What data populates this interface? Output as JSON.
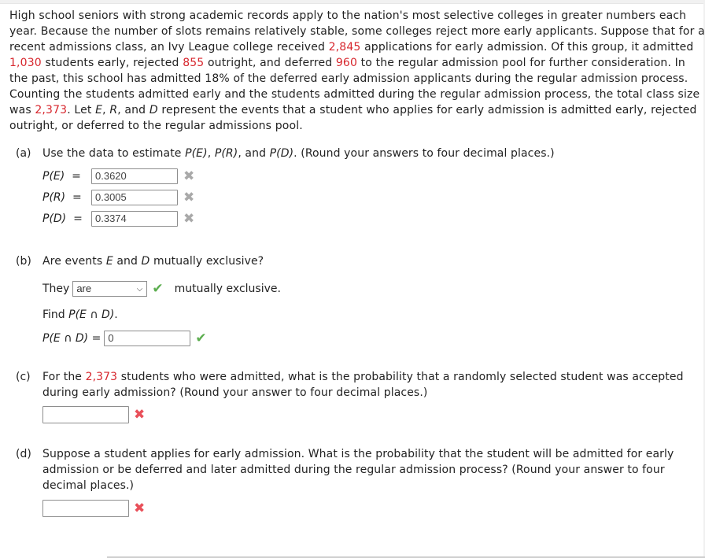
{
  "intro": {
    "l1": "High school seniors with strong academic records apply to the nation's most selective colleges in greater numbers each",
    "l2": "year. Because the number of slots remains relatively stable, some colleges reject more early applicants. Suppose that for a",
    "l3a": "recent admissions class, an Ivy League college received ",
    "applications": "2,845",
    "l3b": " applications for early admission. Of this group, it admitted",
    "admitted_early": "1,030",
    "l4a": " students early, rejected ",
    "rejected": "855",
    "l4b": " outright, and deferred ",
    "deferred": "960",
    "l4c": " to the regular admission pool for further consideration. In",
    "l5": "the past, this school has admitted 18% of the deferred early admission applicants during the regular admission process.",
    "l6": "Counting the students admitted early and the students admitted during the regular admission process, the total class size",
    "l7a": "was ",
    "class_size": "2,373",
    "l7b": ". Let ",
    "E": "E",
    "comma1": ", ",
    "R": "R",
    "and": ", and ",
    "D": "D",
    "l7c": " represent the events that a student who applies for early admission is admitted early, rejected",
    "l8": "outright, or deferred to the regular admissions pool."
  },
  "part_a": {
    "label": "(a)",
    "q1": "Use the data to estimate ",
    "pe": "P(E)",
    "sep1": ", ",
    "pr": "P(R)",
    "sep2": ", and ",
    "pd": "P(D)",
    "q2": ". (Round your answers to four decimal places.)",
    "answers": [
      {
        "label": "P(E)",
        "eq": "=",
        "value": "0.3620",
        "status": "incorrect"
      },
      {
        "label": "P(R)",
        "eq": "=",
        "value": "0.3005",
        "status": "incorrect"
      },
      {
        "label": "P(D)",
        "eq": "=",
        "value": "0.3374",
        "status": "incorrect"
      }
    ]
  },
  "part_b": {
    "label": "(b)",
    "q1": "Are events ",
    "E": "E",
    "mid": " and ",
    "D": "D",
    "q2": " mutually exclusive?",
    "they": "They",
    "select_value": "are",
    "after": "mutually exclusive.",
    "find1": "Find ",
    "find_expr": "P(E ∩ D)",
    "find2": ".",
    "answer_label": "P(E ∩ D)",
    "answer_eq": "=",
    "answer_value": "0"
  },
  "part_c": {
    "label": "(c)",
    "l1a": "For the ",
    "num": "2,373",
    "l1b": " students who were admitted, what is the probability that a randomly selected student was accepted",
    "l2": "during early admission? (Round your answer to four decimal places.)",
    "value": ""
  },
  "part_d": {
    "label": "(d)",
    "l1": "Suppose a student applies for early admission. What is the probability that the student will be admitted for early",
    "l2": "admission or be deferred and later admitted during the regular admission process? (Round your answer to four",
    "l3": "decimal places.)",
    "value": ""
  },
  "icons": {
    "x_mark": "✖",
    "check_mark": "✔",
    "chevron": "⌄"
  },
  "colors": {
    "highlight_red": "#d7262d",
    "correct_green": "#5cae4f",
    "incorrect_red": "#e9505a",
    "neutral_gray": "#a9a9a9"
  }
}
